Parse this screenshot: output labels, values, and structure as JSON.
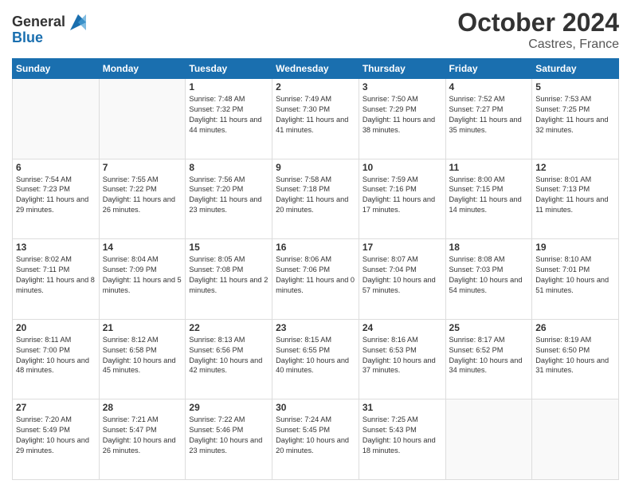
{
  "header": {
    "logo_line1": "General",
    "logo_line2": "Blue",
    "month": "October 2024",
    "location": "Castres, France"
  },
  "days_of_week": [
    "Sunday",
    "Monday",
    "Tuesday",
    "Wednesday",
    "Thursday",
    "Friday",
    "Saturday"
  ],
  "weeks": [
    [
      {
        "day": "",
        "info": ""
      },
      {
        "day": "",
        "info": ""
      },
      {
        "day": "1",
        "info": "Sunrise: 7:48 AM\nSunset: 7:32 PM\nDaylight: 11 hours and 44 minutes."
      },
      {
        "day": "2",
        "info": "Sunrise: 7:49 AM\nSunset: 7:30 PM\nDaylight: 11 hours and 41 minutes."
      },
      {
        "day": "3",
        "info": "Sunrise: 7:50 AM\nSunset: 7:29 PM\nDaylight: 11 hours and 38 minutes."
      },
      {
        "day": "4",
        "info": "Sunrise: 7:52 AM\nSunset: 7:27 PM\nDaylight: 11 hours and 35 minutes."
      },
      {
        "day": "5",
        "info": "Sunrise: 7:53 AM\nSunset: 7:25 PM\nDaylight: 11 hours and 32 minutes."
      }
    ],
    [
      {
        "day": "6",
        "info": "Sunrise: 7:54 AM\nSunset: 7:23 PM\nDaylight: 11 hours and 29 minutes."
      },
      {
        "day": "7",
        "info": "Sunrise: 7:55 AM\nSunset: 7:22 PM\nDaylight: 11 hours and 26 minutes."
      },
      {
        "day": "8",
        "info": "Sunrise: 7:56 AM\nSunset: 7:20 PM\nDaylight: 11 hours and 23 minutes."
      },
      {
        "day": "9",
        "info": "Sunrise: 7:58 AM\nSunset: 7:18 PM\nDaylight: 11 hours and 20 minutes."
      },
      {
        "day": "10",
        "info": "Sunrise: 7:59 AM\nSunset: 7:16 PM\nDaylight: 11 hours and 17 minutes."
      },
      {
        "day": "11",
        "info": "Sunrise: 8:00 AM\nSunset: 7:15 PM\nDaylight: 11 hours and 14 minutes."
      },
      {
        "day": "12",
        "info": "Sunrise: 8:01 AM\nSunset: 7:13 PM\nDaylight: 11 hours and 11 minutes."
      }
    ],
    [
      {
        "day": "13",
        "info": "Sunrise: 8:02 AM\nSunset: 7:11 PM\nDaylight: 11 hours and 8 minutes."
      },
      {
        "day": "14",
        "info": "Sunrise: 8:04 AM\nSunset: 7:09 PM\nDaylight: 11 hours and 5 minutes."
      },
      {
        "day": "15",
        "info": "Sunrise: 8:05 AM\nSunset: 7:08 PM\nDaylight: 11 hours and 2 minutes."
      },
      {
        "day": "16",
        "info": "Sunrise: 8:06 AM\nSunset: 7:06 PM\nDaylight: 11 hours and 0 minutes."
      },
      {
        "day": "17",
        "info": "Sunrise: 8:07 AM\nSunset: 7:04 PM\nDaylight: 10 hours and 57 minutes."
      },
      {
        "day": "18",
        "info": "Sunrise: 8:08 AM\nSunset: 7:03 PM\nDaylight: 10 hours and 54 minutes."
      },
      {
        "day": "19",
        "info": "Sunrise: 8:10 AM\nSunset: 7:01 PM\nDaylight: 10 hours and 51 minutes."
      }
    ],
    [
      {
        "day": "20",
        "info": "Sunrise: 8:11 AM\nSunset: 7:00 PM\nDaylight: 10 hours and 48 minutes."
      },
      {
        "day": "21",
        "info": "Sunrise: 8:12 AM\nSunset: 6:58 PM\nDaylight: 10 hours and 45 minutes."
      },
      {
        "day": "22",
        "info": "Sunrise: 8:13 AM\nSunset: 6:56 PM\nDaylight: 10 hours and 42 minutes."
      },
      {
        "day": "23",
        "info": "Sunrise: 8:15 AM\nSunset: 6:55 PM\nDaylight: 10 hours and 40 minutes."
      },
      {
        "day": "24",
        "info": "Sunrise: 8:16 AM\nSunset: 6:53 PM\nDaylight: 10 hours and 37 minutes."
      },
      {
        "day": "25",
        "info": "Sunrise: 8:17 AM\nSunset: 6:52 PM\nDaylight: 10 hours and 34 minutes."
      },
      {
        "day": "26",
        "info": "Sunrise: 8:19 AM\nSunset: 6:50 PM\nDaylight: 10 hours and 31 minutes."
      }
    ],
    [
      {
        "day": "27",
        "info": "Sunrise: 7:20 AM\nSunset: 5:49 PM\nDaylight: 10 hours and 29 minutes."
      },
      {
        "day": "28",
        "info": "Sunrise: 7:21 AM\nSunset: 5:47 PM\nDaylight: 10 hours and 26 minutes."
      },
      {
        "day": "29",
        "info": "Sunrise: 7:22 AM\nSunset: 5:46 PM\nDaylight: 10 hours and 23 minutes."
      },
      {
        "day": "30",
        "info": "Sunrise: 7:24 AM\nSunset: 5:45 PM\nDaylight: 10 hours and 20 minutes."
      },
      {
        "day": "31",
        "info": "Sunrise: 7:25 AM\nSunset: 5:43 PM\nDaylight: 10 hours and 18 minutes."
      },
      {
        "day": "",
        "info": ""
      },
      {
        "day": "",
        "info": ""
      }
    ]
  ]
}
